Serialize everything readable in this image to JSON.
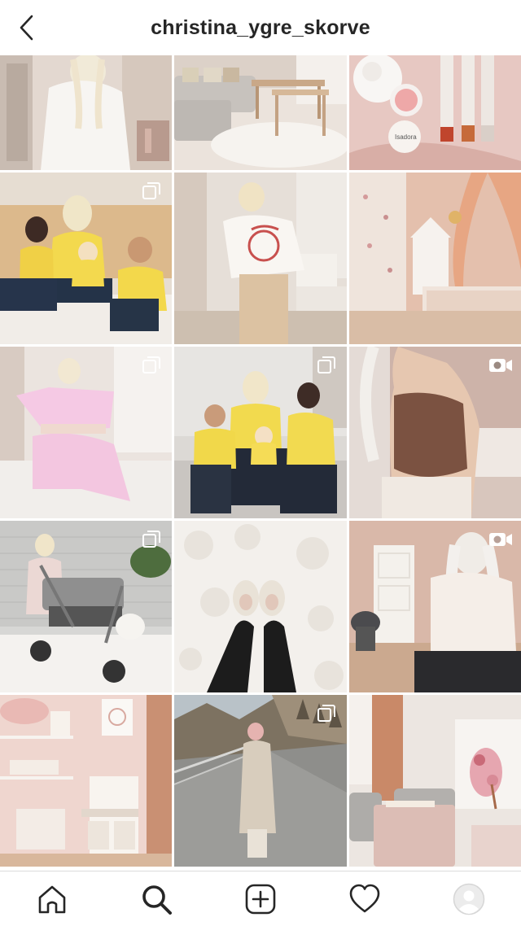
{
  "header": {
    "username": "christina_ygre_skorve",
    "back_icon": "chevron-left-icon"
  },
  "grid": {
    "columns": 3,
    "posts": [
      {
        "type": "photo",
        "scene": "woman-white-outfit-mirror",
        "colors": [
          "#d9cfc8",
          "#f2efec"
        ]
      },
      {
        "type": "photo",
        "scene": "living-room-sofa",
        "colors": [
          "#e7ddd6",
          "#cfc6bf"
        ]
      },
      {
        "type": "photo",
        "scene": "makeup-flatlay-pink",
        "colors": [
          "#e9c9c3",
          "#d6aaa3"
        ]
      },
      {
        "type": "carousel",
        "scene": "family-yellow-sweaters",
        "colors": [
          "#dcc7a8",
          "#f0d454"
        ]
      },
      {
        "type": "photo",
        "scene": "woman-white-sweatshirt-bedroom",
        "colors": [
          "#e6dfd9",
          "#d6c2ad"
        ]
      },
      {
        "type": "photo",
        "scene": "kids-room-canopy-bed",
        "colors": [
          "#e8d3c9",
          "#d8aa97"
        ]
      },
      {
        "type": "carousel",
        "scene": "woman-pink-loungewear",
        "colors": [
          "#e8e0dc",
          "#f1c6df"
        ]
      },
      {
        "type": "carousel",
        "scene": "family-on-sofa-yellow",
        "colors": [
          "#ddd8d2",
          "#f2dc53"
        ]
      },
      {
        "type": "video",
        "scene": "woman-brown-top-braid",
        "colors": [
          "#c9b3aa",
          "#7a5443"
        ]
      },
      {
        "type": "carousel",
        "scene": "toddler-doll-stroller",
        "colors": [
          "#dcdcda",
          "#9a9a9a"
        ]
      },
      {
        "type": "photo",
        "scene": "fluffy-slippers-rug",
        "colors": [
          "#f3f1ee",
          "#e4dfd9"
        ]
      },
      {
        "type": "video",
        "scene": "woman-seated-light-room",
        "colors": [
          "#d9b6a8",
          "#f2ece6"
        ]
      },
      {
        "type": "photo",
        "scene": "pink-playroom-kitchen",
        "colors": [
          "#efd8d2",
          "#e6c1b7"
        ]
      },
      {
        "type": "carousel",
        "scene": "woman-coat-road-mountains",
        "colors": [
          "#b8b6b0",
          "#8d8c86"
        ]
      },
      {
        "type": "photo",
        "scene": "living-room-pink-ottoman",
        "colors": [
          "#ece6e1",
          "#d7b8b0"
        ]
      }
    ]
  },
  "tabbar": {
    "tabs": [
      {
        "name": "home",
        "icon": "home-icon"
      },
      {
        "name": "search",
        "icon": "search-icon",
        "active": true
      },
      {
        "name": "new-post",
        "icon": "plus-square-icon"
      },
      {
        "name": "activity",
        "icon": "heart-icon"
      },
      {
        "name": "profile",
        "icon": "avatar-icon"
      }
    ]
  }
}
